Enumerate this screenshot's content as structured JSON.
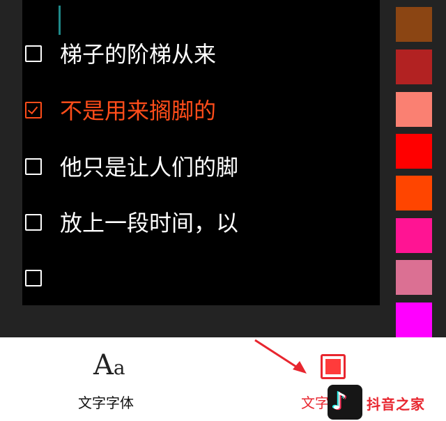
{
  "editor": {
    "lines": [
      {
        "text": "梯子的阶梯从来",
        "checked": false
      },
      {
        "text": "不是用来搁脚的",
        "checked": true
      },
      {
        "text": "他只是让人们的脚",
        "checked": false
      },
      {
        "text": "放上一段时间，以",
        "checked": false
      },
      {
        "text": "",
        "checked": false
      }
    ]
  },
  "palette": {
    "swatches": [
      "#8b4513",
      "#b22222",
      "#fa8072",
      "#ff0000",
      "#ff4500",
      "#ff1493",
      "#db7093",
      "#ff00ff"
    ]
  },
  "toolbar": {
    "font_icon_big": "A",
    "font_icon_small": "a",
    "font_label": "文字字体",
    "color_label": "文字颜色"
  },
  "watermark": {
    "logo": "♪",
    "text": "抖音之家"
  },
  "colors": {
    "accent": "#ff4d1a",
    "selected": "#e8262f"
  }
}
